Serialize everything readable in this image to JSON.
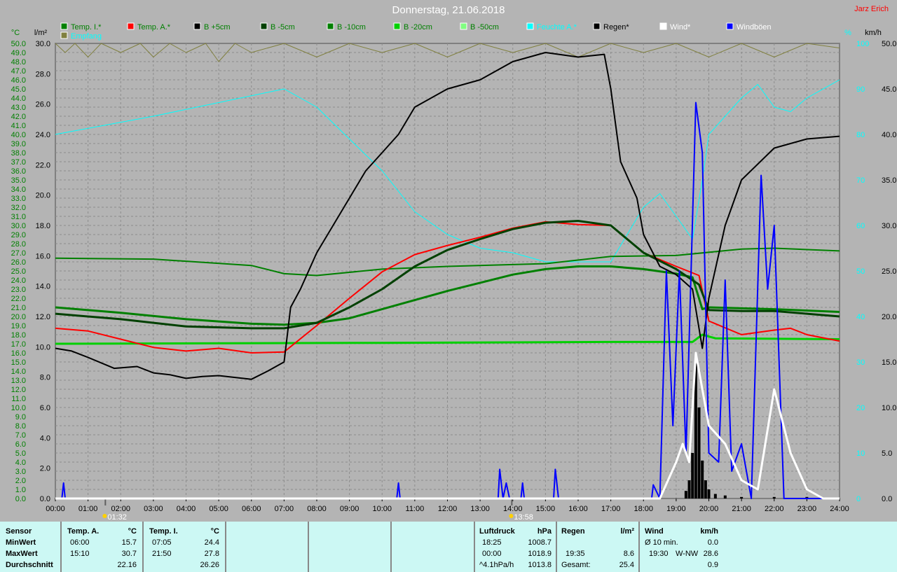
{
  "header": {
    "title": "Donnerstag, 21.06.2018",
    "author": "Jarz Erich"
  },
  "chart_data": {
    "type": "line",
    "title": "Donnerstag, 21.06.2018",
    "axes": {
      "left1": {
        "unit": "°C",
        "range": [
          0,
          50
        ],
        "step": 1
      },
      "left2": {
        "unit": "l/m²",
        "range": [
          0,
          30
        ],
        "step": 2
      },
      "right1": {
        "unit": "%",
        "range": [
          0,
          100
        ],
        "step": 10
      },
      "right2": {
        "unit": "km/h",
        "range": [
          0,
          50
        ],
        "step": 5
      }
    },
    "x_ticks": [
      "00:00",
      "01:00",
      "02:00",
      "03:00",
      "04:00",
      "05:00",
      "06:00",
      "07:00",
      "08:00",
      "09:00",
      "10:00",
      "11:00",
      "12:00",
      "13:00",
      "14:00",
      "15:00",
      "16:00",
      "17:00",
      "18:00",
      "19:00",
      "20:00",
      "21:00",
      "22:00",
      "23:00",
      "24:00"
    ],
    "markers": [
      {
        "time": 1.53,
        "label": "01:32"
      },
      {
        "time": 13.97,
        "label": "13:58"
      }
    ],
    "legend": [
      {
        "name": "Temp. I.*",
        "color": "#008000",
        "text": "#008000"
      },
      {
        "name": "Temp. A.*",
        "color": "#ff0000",
        "text": "#008000"
      },
      {
        "name": "B +5cm",
        "color": "#000000",
        "text": "#008000"
      },
      {
        "name": "B -5cm",
        "color": "#004000",
        "text": "#008000"
      },
      {
        "name": "B -10cm",
        "color": "#008000",
        "text": "#008000"
      },
      {
        "name": "B -20cm",
        "color": "#00d000",
        "text": "#008000"
      },
      {
        "name": "B -50cm",
        "color": "#80ff80",
        "text": "#008000"
      },
      {
        "name": "Feuchte A.*",
        "color": "#00ffff",
        "text": "#00ffff"
      },
      {
        "name": "Regen*",
        "color": "#000000",
        "text": "#000000"
      },
      {
        "name": "Wind*",
        "color": "#ffffff",
        "text": "#ffffff"
      },
      {
        "name": "Windböen",
        "color": "#0000ff",
        "text": "#ffffff"
      },
      {
        "name": "Empfang",
        "color": "#808040",
        "text": "#00ffff"
      }
    ],
    "series": [
      {
        "name": "Temp. I.*",
        "axis": "left1",
        "color": "#008000",
        "width": 2,
        "points": [
          [
            0,
            26.4
          ],
          [
            3,
            26.3
          ],
          [
            6,
            25.6
          ],
          [
            7,
            24.7
          ],
          [
            8,
            24.5
          ],
          [
            10,
            25.2
          ],
          [
            12,
            25.5
          ],
          [
            15,
            25.8
          ],
          [
            17,
            26.6
          ],
          [
            19,
            26.7
          ],
          [
            21,
            27.4
          ],
          [
            22,
            27.5
          ],
          [
            24,
            27.2
          ]
        ]
      },
      {
        "name": "B -20cm",
        "axis": "left1",
        "color": "#00d000",
        "width": 3,
        "points": [
          [
            0,
            17
          ],
          [
            10,
            17.1
          ],
          [
            17,
            17.2
          ],
          [
            19.5,
            17.2
          ],
          [
            19.8,
            18
          ],
          [
            20.2,
            17.6
          ],
          [
            24,
            17.5
          ]
        ]
      },
      {
        "name": "B -10cm",
        "axis": "left1",
        "color": "#008000",
        "width": 3,
        "points": [
          [
            0,
            21
          ],
          [
            2,
            20.4
          ],
          [
            4,
            19.7
          ],
          [
            6,
            19.2
          ],
          [
            7,
            19.1
          ],
          [
            8,
            19.3
          ],
          [
            9,
            19.8
          ],
          [
            10,
            20.8
          ],
          [
            11,
            21.8
          ],
          [
            12,
            22.8
          ],
          [
            13,
            23.7
          ],
          [
            14,
            24.6
          ],
          [
            15,
            25.2
          ],
          [
            16,
            25.5
          ],
          [
            17,
            25.5
          ],
          [
            18,
            25.2
          ],
          [
            19,
            24.7
          ],
          [
            19.5,
            24.3
          ],
          [
            19.8,
            20.8
          ],
          [
            20,
            21
          ],
          [
            22,
            20.8
          ],
          [
            24,
            20.5
          ]
        ]
      },
      {
        "name": "Temp. A.*",
        "axis": "left1",
        "color": "#ff0000",
        "width": 2,
        "points": [
          [
            0,
            18.7
          ],
          [
            1,
            18.4
          ],
          [
            2,
            17.5
          ],
          [
            3,
            16.6
          ],
          [
            4,
            16.2
          ],
          [
            5,
            16.5
          ],
          [
            6,
            16
          ],
          [
            7,
            16.1
          ],
          [
            8,
            19
          ],
          [
            9,
            22
          ],
          [
            10,
            24.9
          ],
          [
            11,
            26.8
          ],
          [
            12,
            27.8
          ],
          [
            13,
            28.7
          ],
          [
            14,
            29.7
          ],
          [
            15,
            30.4
          ],
          [
            16,
            30.1
          ],
          [
            17,
            30
          ],
          [
            17.5,
            28.5
          ],
          [
            18,
            27
          ],
          [
            19,
            25.5
          ],
          [
            19.7,
            24.5
          ],
          [
            20,
            19.5
          ],
          [
            21,
            18
          ],
          [
            22,
            18.5
          ],
          [
            22.5,
            18.7
          ],
          [
            23,
            18
          ],
          [
            24,
            17.3
          ]
        ]
      },
      {
        "name": "B -5cm",
        "axis": "left1",
        "color": "#004000",
        "width": 3,
        "points": [
          [
            0,
            20.3
          ],
          [
            2,
            19.7
          ],
          [
            4,
            18.9
          ],
          [
            6,
            18.7
          ],
          [
            7,
            18.7
          ],
          [
            8,
            19.3
          ],
          [
            9,
            21
          ],
          [
            10,
            23
          ],
          [
            11,
            25.5
          ],
          [
            12,
            27.3
          ],
          [
            13,
            28.5
          ],
          [
            14,
            29.6
          ],
          [
            15,
            30.3
          ],
          [
            16,
            30.5
          ],
          [
            17,
            30
          ],
          [
            18,
            27
          ],
          [
            19,
            25.2
          ],
          [
            19.7,
            23.5
          ],
          [
            20,
            20.7
          ],
          [
            21,
            20.6
          ],
          [
            22,
            20.6
          ],
          [
            23,
            20.3
          ],
          [
            24,
            20
          ]
        ]
      },
      {
        "name": "B +5cm",
        "axis": "left1",
        "color": "#000000",
        "width": 2,
        "points": [
          [
            0,
            16.5
          ],
          [
            0.5,
            16.2
          ],
          [
            1,
            15.5
          ],
          [
            1.8,
            14.3
          ],
          [
            2.5,
            14.5
          ],
          [
            3,
            13.8
          ],
          [
            3.5,
            13.6
          ],
          [
            4,
            13.2
          ],
          [
            4.5,
            13.4
          ],
          [
            5,
            13.5
          ],
          [
            6,
            13.1
          ],
          [
            6.5,
            14
          ],
          [
            7,
            15
          ],
          [
            7.2,
            21
          ],
          [
            7.5,
            23
          ],
          [
            8,
            27
          ],
          [
            8.5,
            30
          ],
          [
            9,
            33
          ],
          [
            9.5,
            36
          ],
          [
            10,
            38
          ],
          [
            10.5,
            40
          ],
          [
            11,
            43
          ],
          [
            12,
            45
          ],
          [
            13,
            46
          ],
          [
            14,
            48
          ],
          [
            15,
            49
          ],
          [
            16,
            48.5
          ],
          [
            16.8,
            48.8
          ],
          [
            17,
            45
          ],
          [
            17.3,
            37
          ],
          [
            17.8,
            33
          ],
          [
            18,
            29
          ],
          [
            18.5,
            25.5
          ],
          [
            19,
            24.6
          ],
          [
            19.5,
            23
          ],
          [
            19.8,
            16.5
          ],
          [
            20,
            22
          ],
          [
            20.5,
            30
          ],
          [
            21,
            35
          ],
          [
            22,
            38.5
          ],
          [
            23,
            39.5
          ],
          [
            24,
            39.8
          ]
        ]
      },
      {
        "name": "Feuchte A.*",
        "axis": "right1",
        "color": "#00ffff",
        "width": 1,
        "points": [
          [
            0,
            80
          ],
          [
            1.5,
            82
          ],
          [
            3,
            84
          ],
          [
            5,
            87
          ],
          [
            7,
            90
          ],
          [
            8,
            86
          ],
          [
            9,
            79
          ],
          [
            10,
            72
          ],
          [
            11,
            63
          ],
          [
            12,
            58
          ],
          [
            13,
            55
          ],
          [
            14,
            54
          ],
          [
            15,
            52
          ],
          [
            16,
            52
          ],
          [
            17,
            52
          ],
          [
            18,
            64
          ],
          [
            18.5,
            67
          ],
          [
            19,
            62
          ],
          [
            19.5,
            57
          ],
          [
            19.8,
            70
          ],
          [
            20,
            80
          ],
          [
            21,
            88
          ],
          [
            21.5,
            91
          ],
          [
            22,
            86
          ],
          [
            22.5,
            85
          ],
          [
            23,
            88
          ],
          [
            24,
            92
          ]
        ]
      },
      {
        "name": "Empfang",
        "axis": "right1",
        "color": "#808040",
        "width": 1,
        "points": [
          [
            0,
            100
          ],
          [
            0.3,
            98
          ],
          [
            0.6,
            100
          ],
          [
            1,
            97
          ],
          [
            1.4,
            100
          ],
          [
            2,
            98
          ],
          [
            2.6,
            100
          ],
          [
            3,
            97
          ],
          [
            3.5,
            100
          ],
          [
            4,
            98
          ],
          [
            4.6,
            100
          ],
          [
            5,
            96
          ],
          [
            5.5,
            100
          ],
          [
            6,
            98
          ],
          [
            7,
            100
          ],
          [
            8,
            97
          ],
          [
            9,
            100
          ],
          [
            10,
            98
          ],
          [
            11,
            100
          ],
          [
            12,
            97
          ],
          [
            13,
            100
          ],
          [
            14,
            98
          ],
          [
            15,
            100
          ],
          [
            16,
            97
          ],
          [
            17,
            100
          ],
          [
            18,
            98
          ],
          [
            19,
            100
          ],
          [
            20,
            97
          ],
          [
            21,
            100
          ],
          [
            22,
            97
          ],
          [
            23,
            100
          ],
          [
            24,
            99
          ]
        ]
      },
      {
        "name": "Windböen",
        "axis": "right2",
        "color": "#0000ff",
        "width": 2,
        "points": [
          [
            0,
            0
          ],
          [
            0.2,
            0
          ],
          [
            0.25,
            1.7
          ],
          [
            0.3,
            0
          ],
          [
            10.45,
            0
          ],
          [
            10.5,
            1.7
          ],
          [
            10.55,
            0
          ],
          [
            13.55,
            0
          ],
          [
            13.6,
            3.2
          ],
          [
            13.7,
            0
          ],
          [
            13.8,
            1.7
          ],
          [
            13.9,
            0
          ],
          [
            14.25,
            0
          ],
          [
            14.3,
            1.7
          ],
          [
            14.35,
            0
          ],
          [
            15.25,
            0
          ],
          [
            15.3,
            3.2
          ],
          [
            15.4,
            0
          ],
          [
            18.25,
            0
          ],
          [
            18.3,
            1.5
          ],
          [
            18.5,
            0
          ],
          [
            18.7,
            25
          ],
          [
            18.9,
            8
          ],
          [
            19.1,
            25
          ],
          [
            19.3,
            5
          ],
          [
            19.6,
            43.5
          ],
          [
            19.8,
            38
          ],
          [
            20,
            5
          ],
          [
            20.3,
            4
          ],
          [
            20.5,
            24
          ],
          [
            20.7,
            3
          ],
          [
            21,
            6
          ],
          [
            21.3,
            0
          ],
          [
            21.6,
            35.5
          ],
          [
            21.8,
            23
          ],
          [
            22,
            30
          ],
          [
            22.3,
            0
          ],
          [
            24,
            0
          ]
        ]
      },
      {
        "name": "Wind*",
        "axis": "right2",
        "color": "#ffffff",
        "width": 3,
        "points": [
          [
            0,
            0
          ],
          [
            18.5,
            0
          ],
          [
            19,
            4
          ],
          [
            19.2,
            6
          ],
          [
            19.4,
            4
          ],
          [
            19.6,
            16
          ],
          [
            20,
            8
          ],
          [
            20.5,
            6
          ],
          [
            21,
            2
          ],
          [
            21.5,
            1
          ],
          [
            22,
            12
          ],
          [
            22.5,
            5
          ],
          [
            23,
            1
          ],
          [
            23.5,
            0
          ],
          [
            24,
            0
          ]
        ]
      }
    ],
    "rain_bars": {
      "axis": "left2",
      "color": "#000000",
      "values": [
        [
          19.3,
          0.5
        ],
        [
          19.4,
          1.2
        ],
        [
          19.5,
          3
        ],
        [
          19.6,
          8.9
        ],
        [
          19.7,
          6
        ],
        [
          19.8,
          2.5
        ],
        [
          19.9,
          1.2
        ],
        [
          20,
          0.6
        ],
        [
          20.2,
          0.3
        ],
        [
          20.5,
          0.2
        ],
        [
          21,
          0.1
        ],
        [
          22,
          0.1
        ],
        [
          23,
          0.1
        ]
      ]
    }
  },
  "table": {
    "sensor": {
      "h": "Sensor",
      "r1": "MinWert",
      "r2": "MaxWert",
      "r3": "Durchschnitt"
    },
    "temp_a": {
      "h": "Temp. A.",
      "u": "°C",
      "t1": "06:00",
      "v1": "15.7",
      "t2": "15:10",
      "v2": "30.7",
      "v3": "22.16"
    },
    "temp_i": {
      "h": "Temp. I.",
      "u": "°C",
      "t1": "07:05",
      "v1": "24.4",
      "t2": "21:50",
      "v2": "27.8",
      "v3": "26.26"
    },
    "luft": {
      "h": "Luftdruck",
      "u": "hPa",
      "t1": "18:25",
      "v1": "1008.7",
      "t2": "00:00",
      "v2": "1018.9",
      "t3": "^4.1hPa/h",
      "v3": "1013.8"
    },
    "regen": {
      "h": "Regen",
      "u": "l/m²",
      "t2": "19:35",
      "v2": "8.6",
      "t3": "Gesamt:",
      "v3": "25.4"
    },
    "wind": {
      "h": "Wind",
      "u": "km/h",
      "t1": "Ø 10 min.",
      "v1": "0.0",
      "t2": "19:30",
      "d2": "W-NW",
      "v2": "28.6",
      "v3": "0.9"
    }
  }
}
